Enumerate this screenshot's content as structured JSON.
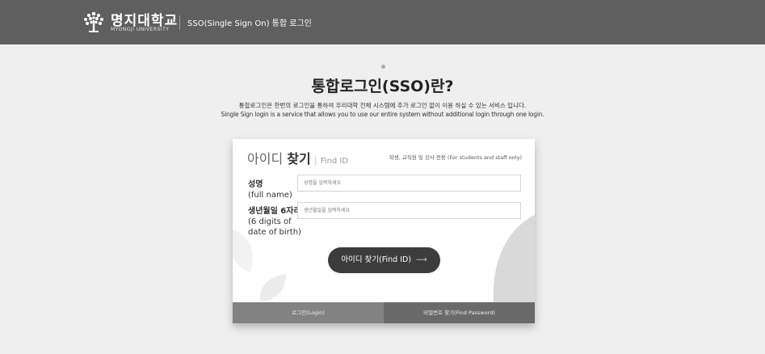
{
  "header": {
    "logo_text": "명지대학교",
    "logo_sub": "MYONGJI UNIVERSITY",
    "service_title": "SSO(Single Sign On) 통합 로그인"
  },
  "intro": {
    "title": "통합로그인(SSO)란?",
    "desc_ko": "통합로그인은 한번의 로그인을 통하여 우리대학 전체 시스템에 추가 로그인 없이 이용 하실 수 있는 서비스 입니다.",
    "desc_en": "Single Sign login is a service that allows you to use our entire system without additional login through one login."
  },
  "card": {
    "title_ko_light": "아이디",
    "title_ko_bold": "찾기",
    "title_sep": "|",
    "title_en": "Find ID",
    "note": "학생, 교직원 및 강사 전용 (For students and staff only)",
    "fields": [
      {
        "label_ko": "성명",
        "label_en": "(full name)",
        "placeholder": "성명을 입력하세요"
      },
      {
        "label_ko": "생년월일 6자리",
        "label_en_1": "(6 digits of",
        "label_en_2": "date of birth)",
        "placeholder": "생년월일을 입력하세요"
      }
    ],
    "submit_label": "아이디 찾기(Find ID)",
    "submit_arrow": "⟶",
    "tabs": {
      "login": "로그인(Login)",
      "find_password": "비밀번호 찾기(Find Password)"
    }
  },
  "colors": {
    "header_bg": "#5f5f5f",
    "page_bg": "#efefef",
    "button_bg": "#3c3c3c",
    "tab_login_bg": "#828282",
    "tab_password_bg": "#6a6a6a"
  },
  "icons": {
    "logo": "university-tree-emblem-icon",
    "submit_arrow": "long-right-arrow-icon",
    "decor": "leaf-shape"
  }
}
